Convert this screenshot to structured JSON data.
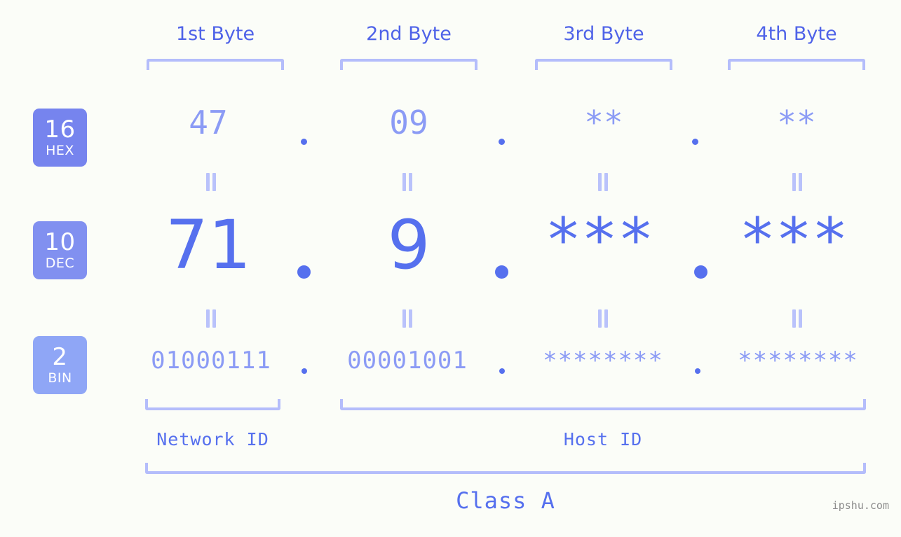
{
  "background_color": "#fbfdf8",
  "accent_color": "#5670ee",
  "accent_light": "#8b9bf5",
  "bracket_color": "#b4bdfb",
  "bases": [
    {
      "number": "16",
      "name": "HEX",
      "color": "#7684ee"
    },
    {
      "number": "10",
      "name": "DEC",
      "color": "#8190f0"
    },
    {
      "number": "2",
      "name": "BIN",
      "color": "#8fa6f6"
    }
  ],
  "byte_headers": [
    {
      "label": "1st Byte"
    },
    {
      "label": "2nd Byte"
    },
    {
      "label": "3rd Byte"
    },
    {
      "label": "4th Byte"
    }
  ],
  "rows": {
    "hex": {
      "values": [
        "47",
        "09",
        "**",
        "**"
      ],
      "separator": "."
    },
    "dec": {
      "values": [
        "71",
        "9",
        "***",
        "***"
      ],
      "separator": "."
    },
    "bin": {
      "values": [
        "01000111",
        "00001001",
        "********",
        "********"
      ],
      "separator": "."
    }
  },
  "equals_symbol": "=",
  "segments": {
    "network_id": "Network ID",
    "host_id": "Host ID",
    "class": "Class A"
  },
  "watermark": "ipshu.com"
}
